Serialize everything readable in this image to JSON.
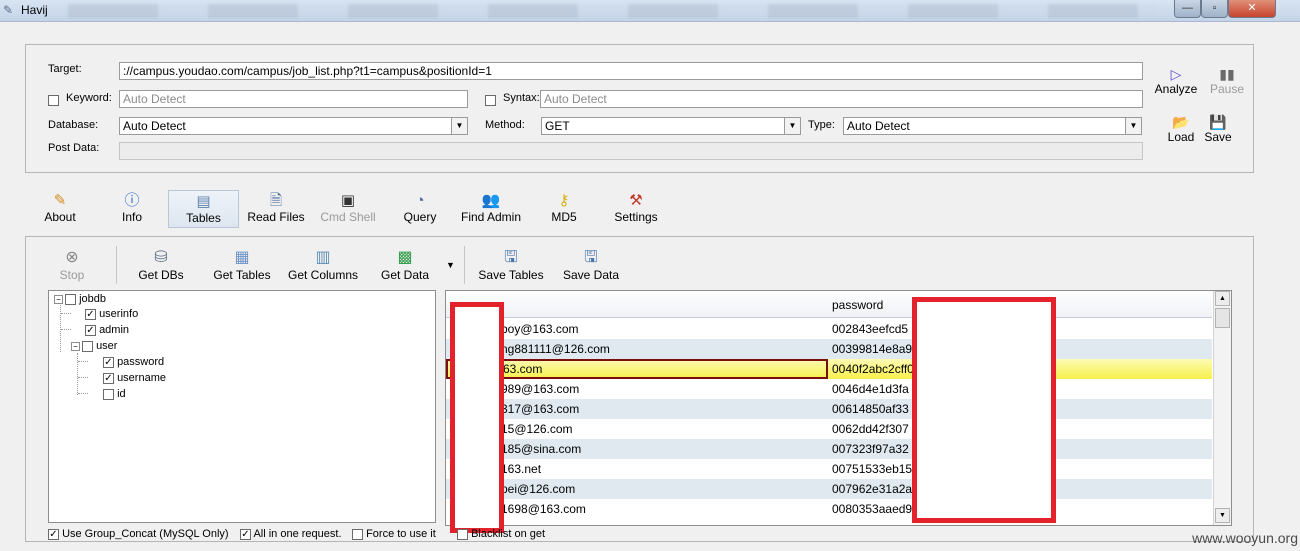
{
  "window": {
    "title": "Havij"
  },
  "target": {
    "target_label": "Target:",
    "target_value": "://campus.youdao.com/campus/job_list.php?t1=campus&positionId=1",
    "keyword_label": "Keyword:",
    "keyword_placeholder": "Auto Detect",
    "syntax_label": "Syntax:",
    "syntax_placeholder": "Auto Detect",
    "database_label": "Database:",
    "database_value": "Auto Detect",
    "method_label": "Method:",
    "method_value": "GET",
    "type_label": "Type:",
    "type_value": "Auto Detect",
    "postdata_label": "Post Data:"
  },
  "side_buttons": {
    "analyze": "Analyze",
    "pause": "Pause",
    "load": "Load",
    "save": "Save"
  },
  "toolbar": [
    {
      "label": "About",
      "icon": "pencil-icon"
    },
    {
      "label": "Info",
      "icon": "info-icon"
    },
    {
      "label": "Tables",
      "icon": "table-icon"
    },
    {
      "label": "Read Files",
      "icon": "document-icon"
    },
    {
      "label": "Cmd Shell",
      "icon": "terminal-icon"
    },
    {
      "label": "Query",
      "icon": "query-icon"
    },
    {
      "label": "Find Admin",
      "icon": "users-icon"
    },
    {
      "label": "MD5",
      "icon": "key-icon"
    },
    {
      "label": "Settings",
      "icon": "tools-icon"
    }
  ],
  "subtoolbar": {
    "stop": "Stop",
    "get_dbs": "Get DBs",
    "get_tables": "Get Tables",
    "get_columns": "Get Columns",
    "get_data": "Get Data",
    "save_tables": "Save Tables",
    "save_data": "Save Data"
  },
  "tree": {
    "db": "jobdb",
    "tables": [
      "userinfo",
      "admin",
      "user"
    ],
    "columns": [
      "password",
      "username",
      "id"
    ]
  },
  "grid": {
    "col2_header": "password",
    "rows": [
      {
        "c1": "boy@163.com",
        "c2": "002843eefcd5"
      },
      {
        "c1": "ng881111@126.com",
        "c2": "00399814e8a9"
      },
      {
        "c1": "63.com",
        "c2": "0040f2abc2cff0"
      },
      {
        "c1": "989@163.com",
        "c2": "0046d4e1d3fa"
      },
      {
        "c1": "317@163.com",
        "c2": "00614850af33"
      },
      {
        "c1": "15@126.com",
        "c2": "0062dd42f307"
      },
      {
        "c1": "185@sina.com",
        "c2": "007323f97a32"
      },
      {
        "c1": "163.net",
        "c2": "00751533eb15"
      },
      {
        "c1": "pei@126.com",
        "c2": "007962e31a2a"
      },
      {
        "c1": "1698@163.com",
        "c2": "0080353aaed9"
      }
    ],
    "selected_row": 2
  },
  "options": {
    "group_concat": "Use Group_Concat (MySQL Only)",
    "all_in_one": "All in one request.",
    "force": "Force to use it",
    "blacklist": "Blacklist on get"
  },
  "watermark": "www.wooyun.org",
  "colors": {
    "redaction": "#e3222b",
    "selection": "#f6f04a",
    "row_alt": "#dfe9ef"
  }
}
